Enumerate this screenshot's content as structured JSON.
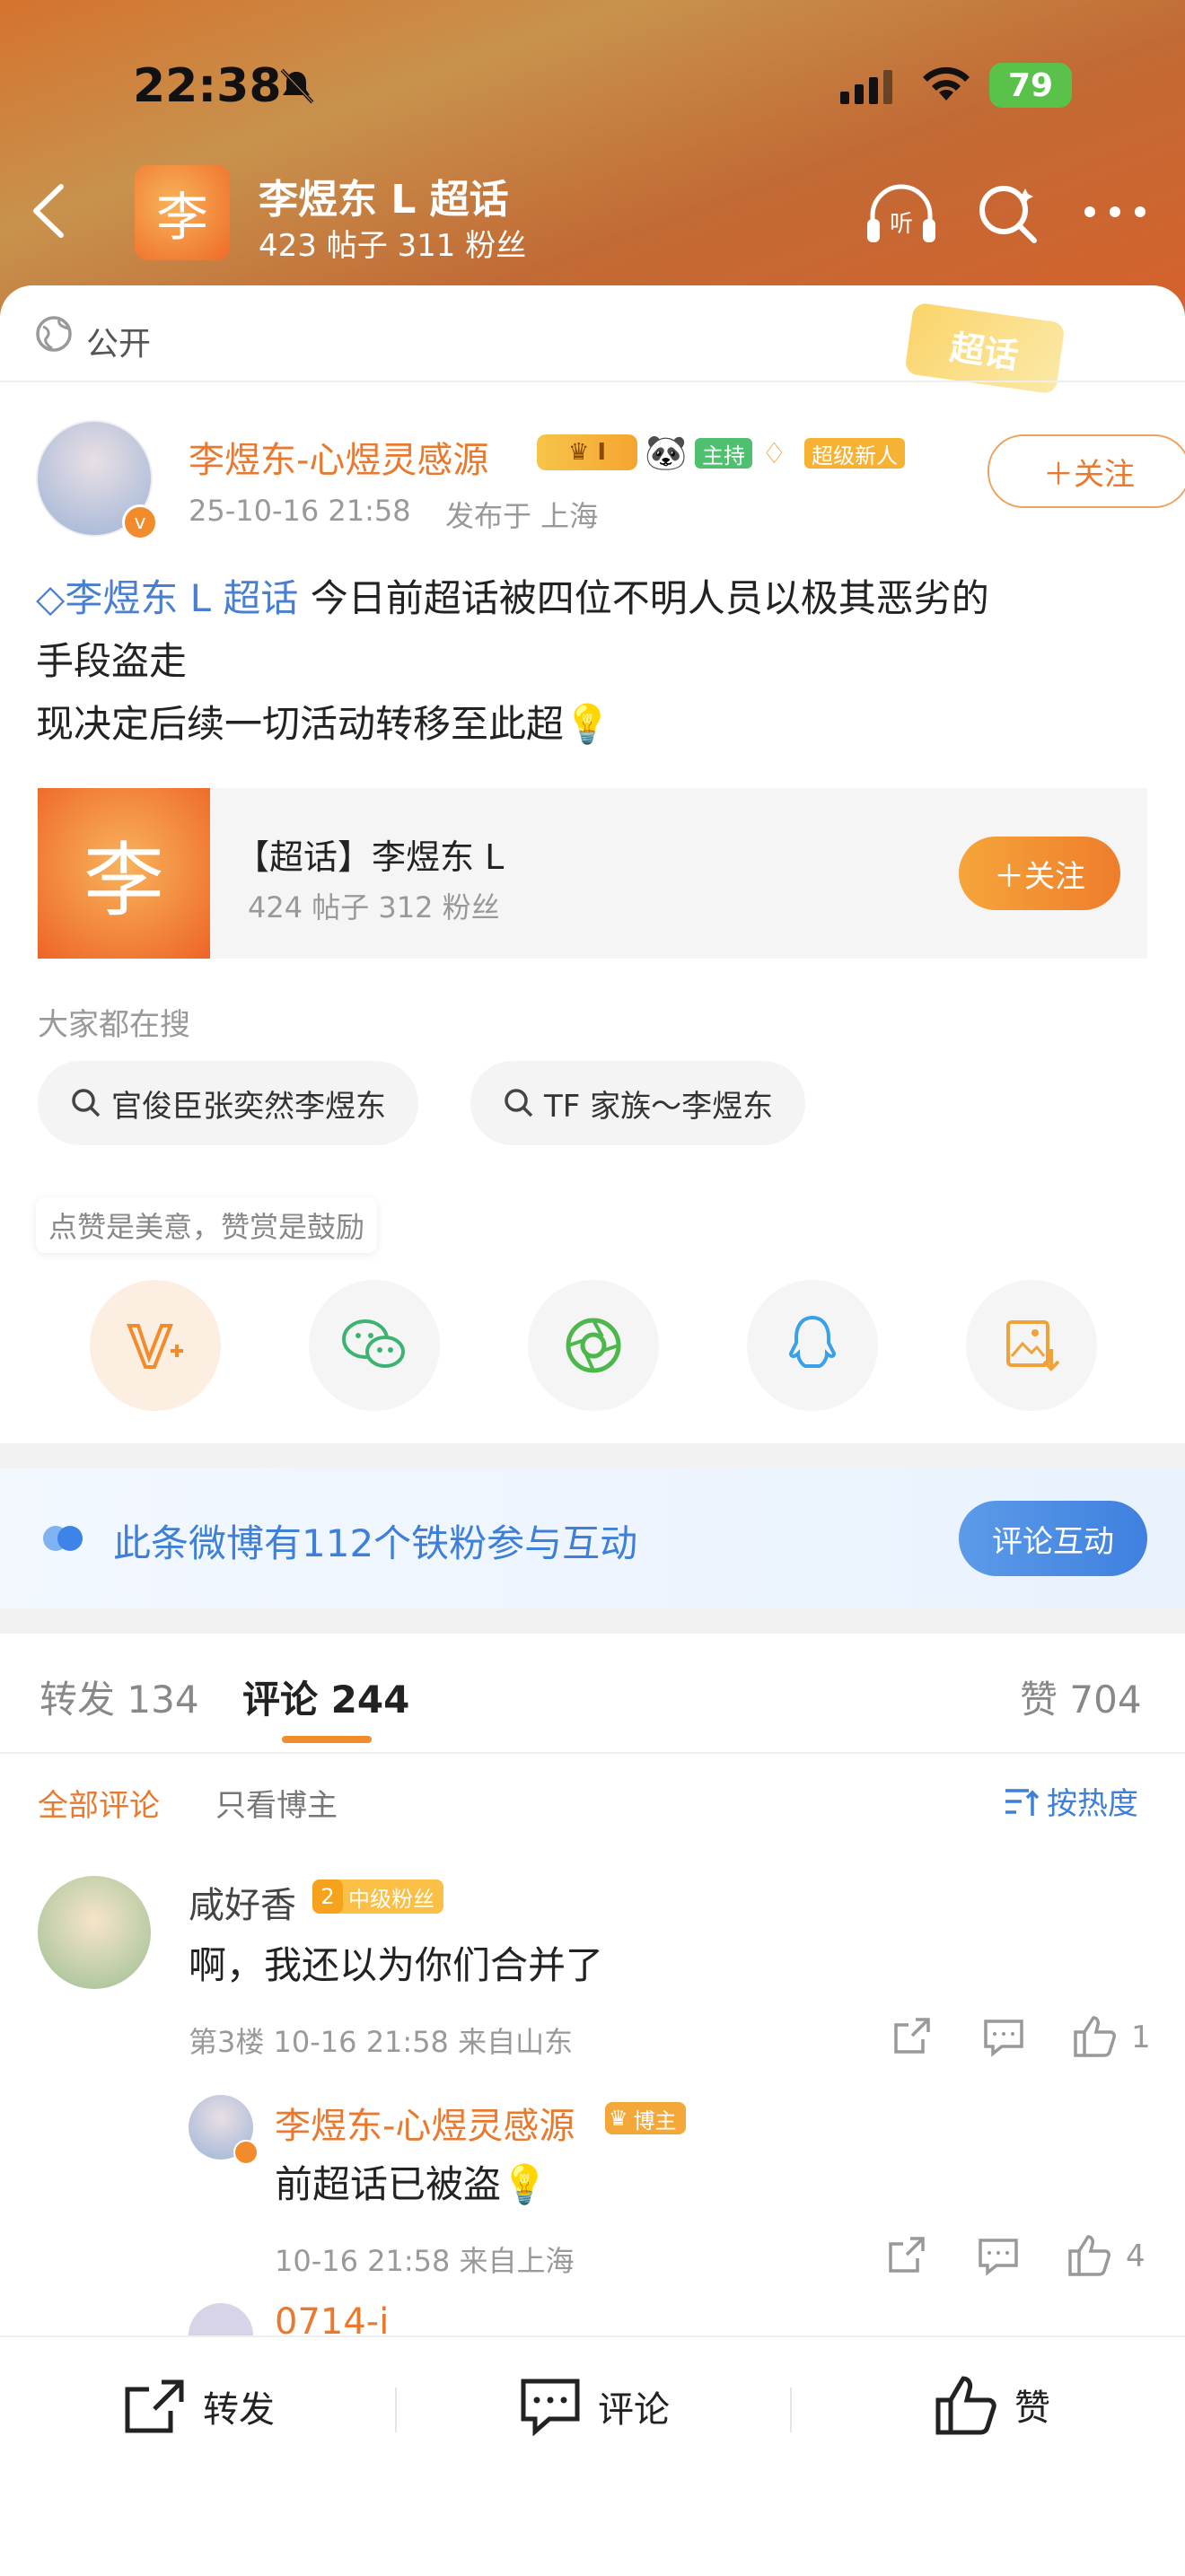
{
  "status_bar": {
    "time": "22:38",
    "battery": "79"
  },
  "header": {
    "avatar_char": "李",
    "title": "李煜东 L 超话",
    "subtitle": "423 帖子 311 粉丝"
  },
  "visibility": {
    "label": "公开",
    "badge": "超话"
  },
  "post": {
    "author": "李煜东-心煜灵感源",
    "badge_host": "主持",
    "badge_new": "超级新人",
    "time": "25-10-16 21:58",
    "location": "发布于 上海",
    "follow_label": "＋关注",
    "topic_link": "李煜东 L 超话",
    "text_line1": " 今日前超话被四位不明人员以极其恶劣的",
    "text_line2": "手段盗走",
    "text_line3": "现决定后续一切活动转移至此超"
  },
  "supertopic_card": {
    "avatar_char": "李",
    "name": "【超话】李煜东 L",
    "stats": "424 帖子 312 粉丝",
    "follow_label": "＋关注"
  },
  "search": {
    "label": "大家都在搜",
    "items": [
      "官俊臣张奕然李煜东",
      "TF 家族～李煜东"
    ]
  },
  "reward": {
    "tip": "点赞是美意，赞赏是鼓励"
  },
  "share_icons": [
    "reward-v-icon",
    "wechat-icon",
    "moments-icon",
    "qq-icon",
    "save-image-icon"
  ],
  "interaction": {
    "text": "此条微博有112个铁粉参与互动",
    "button": "评论互动"
  },
  "tabs": {
    "repost": "转发",
    "repost_count": "134",
    "comment": "评论",
    "comment_count": "244",
    "like": "赞",
    "like_count": "704"
  },
  "filters": {
    "all": "全部评论",
    "blogger": "只看博主",
    "sort": "按热度"
  },
  "comments": [
    {
      "user": "咸好香",
      "fan_level": "2",
      "fan_badge": "中级粉丝",
      "text": "啊，我还以为你们合并了",
      "meta": "第3楼 10-16 21:58 来自山东",
      "likes": "1"
    }
  ],
  "reply": {
    "user": "李煜东-心煜灵感源",
    "badge": "博主",
    "text": "前超话已被盗",
    "meta": "10-16 21:58 来自上海",
    "likes": "4"
  },
  "next_comment": {
    "user": "0714-i"
  },
  "bottom_bar": {
    "repost": "转发",
    "comment": "评论",
    "like": "赞"
  },
  "colors": {
    "accent": "#e8792f",
    "link": "#4a7fd0",
    "bg_gray": "#f2f2f2"
  }
}
